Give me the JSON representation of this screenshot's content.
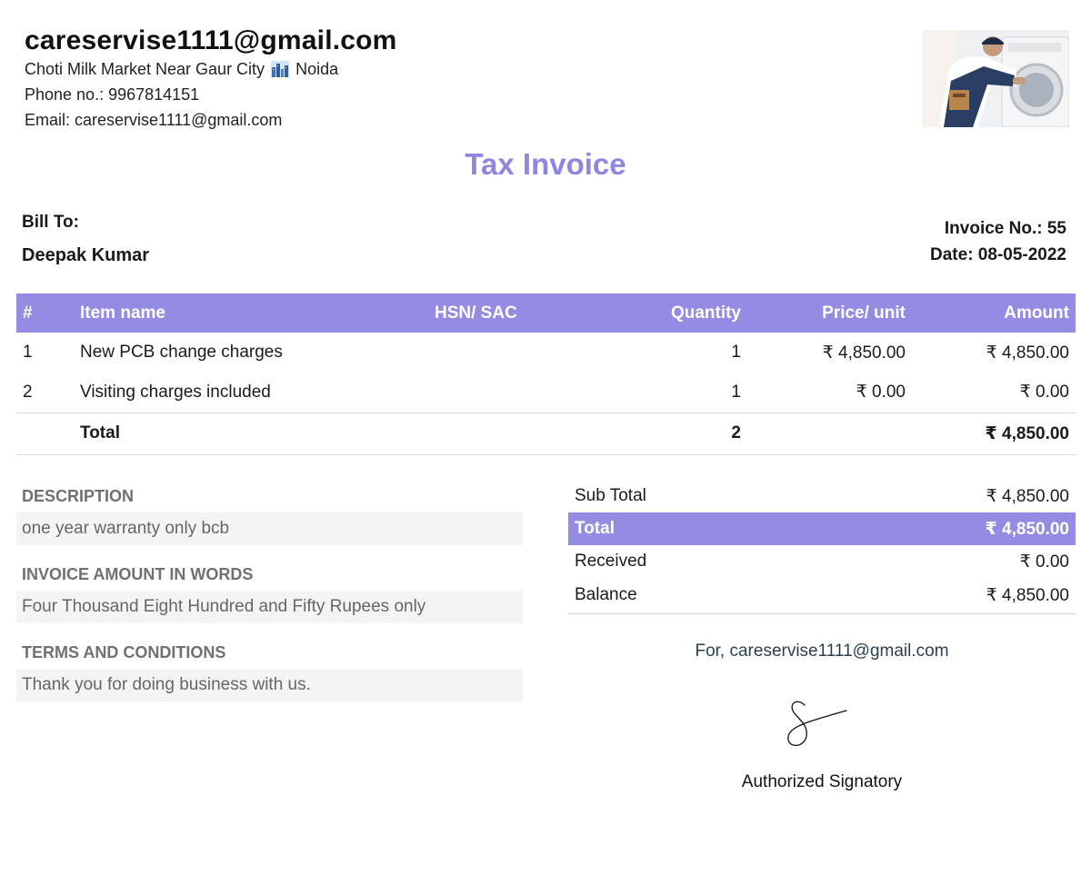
{
  "company": {
    "name": "careservise1111@gmail.com",
    "address_before_icon": "Choti Milk Market Near Gaur City",
    "address_icon": "cityscape-icon",
    "address_after_icon": "Noida",
    "phone": "Phone no.: 9967814151",
    "email": "Email: careservise1111@gmail.com"
  },
  "photo": {
    "subject": "technician repairing washing machine"
  },
  "title": "Tax Invoice",
  "bill_to": {
    "label": "Bill To:",
    "name": "Deepak Kumar"
  },
  "invoice": {
    "number": "Invoice No.: 55",
    "date": "Date: 08-05-2022"
  },
  "items_table": {
    "headers": [
      "#",
      "Item name",
      "HSN/ SAC",
      "Quantity",
      "Price/ unit",
      "Amount"
    ],
    "rows": [
      {
        "no": "1",
        "name": "New PCB change charges",
        "hsn": "",
        "qty": "1",
        "price": "₹ 4,850.00",
        "amount": "₹ 4,850.00"
      },
      {
        "no": "2",
        "name": "Visiting charges included",
        "hsn": "",
        "qty": "1",
        "price": "₹ 0.00",
        "amount": "₹ 0.00"
      }
    ],
    "total": {
      "label": "Total",
      "qty": "2",
      "amount": "₹ 4,850.00"
    }
  },
  "description": {
    "title": "DESCRIPTION",
    "text": "one year warranty only bcb"
  },
  "amount_in_words": {
    "title": "INVOICE AMOUNT IN WORDS",
    "text": "Four Thousand Eight Hundred and Fifty Rupees only"
  },
  "terms": {
    "title": "TERMS AND CONDITIONS",
    "text": "Thank you for doing business with us."
  },
  "summary": {
    "sub_total_label": "Sub Total",
    "sub_total_value": "₹ 4,850.00",
    "total_label": "Total",
    "total_value": "₹ 4,850.00",
    "received_label": "Received",
    "received_value": "₹ 0.00",
    "balance_label": "Balance",
    "balance_value": "₹ 4,850.00"
  },
  "signatory": {
    "for_line": "For, careservise1111@gmail.com",
    "label": "Authorized Signatory"
  },
  "colors": {
    "accent": "#948be3",
    "title": "#8f86e0",
    "section_title": "#707070",
    "section_bg": "#f4f4f4"
  }
}
